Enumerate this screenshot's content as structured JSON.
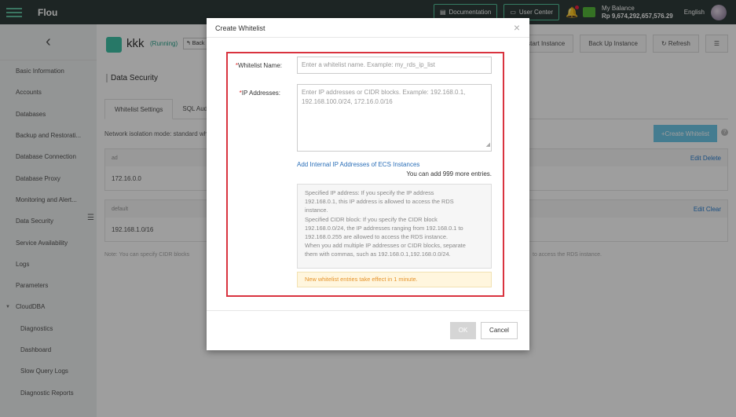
{
  "topbar": {
    "logo_text": "Flou",
    "documentation_label": "Documentation",
    "user_center_label": "User Center",
    "balance_label": "My Balance",
    "balance_value": "Rp 9,674,292,657,576.29",
    "language": "English"
  },
  "sidebar": {
    "back_icon": "‹",
    "items": [
      {
        "label": "Basic Information"
      },
      {
        "label": "Accounts"
      },
      {
        "label": "Databases"
      },
      {
        "label": "Backup and Restorati..."
      },
      {
        "label": "Database Connection"
      },
      {
        "label": "Database Proxy"
      },
      {
        "label": "Monitoring and Alert..."
      },
      {
        "label": "Data Security"
      },
      {
        "label": "Service Availability"
      },
      {
        "label": "Logs"
      },
      {
        "label": "Parameters"
      },
      {
        "label": "CloudDBA"
      },
      {
        "label": "Diagnostics"
      },
      {
        "label": "Dashboard"
      },
      {
        "label": "Slow Query Logs"
      },
      {
        "label": "Diagnostic Reports"
      }
    ]
  },
  "instance": {
    "name": "kkk",
    "status": "(Running)",
    "back_label": "↰ Back"
  },
  "actions": {
    "restart": "Restart Instance",
    "backup": "Back Up Instance",
    "refresh": "↻ Refresh",
    "menu": "☰"
  },
  "page": {
    "section_title": "Data Security",
    "tabs": [
      "Whitelist Settings",
      "SQL Audit"
    ],
    "isolation_mode": "Network isolation mode: standard whitelist.",
    "create_whitelist": "+Create Whitelist",
    "help": "?",
    "groups": [
      {
        "name": "ad",
        "ip": "172.16.0.0",
        "links": "Edit Delete"
      },
      {
        "name": "default",
        "ip": "192.168.1.0/16",
        "links": "Edit Clear"
      }
    ],
    "note_left": "Note: You can specify CIDR blocks",
    "note_right": "to access the RDS instance."
  },
  "modal": {
    "title": "Create Whitelist",
    "close": "×",
    "name_label": "Whitelist Name:",
    "name_placeholder": "Enter a whitelist name. Example: my_rds_ip_list",
    "ip_label": "IP Addresses:",
    "ip_placeholder_lines": [
      "Enter IP addresses or CIDR blocks. Example: 192.168.0.1,",
      "192.168.100.0/24, 172.16.0.0/16"
    ],
    "add_internal_link": "Add Internal IP Addresses of ECS Instances",
    "more_entries": "You can add 999 more entries.",
    "info_lines": [
      "Specified IP address: If you specify the IP address",
      "192.168.0.1, this IP address is allowed to access the RDS",
      "instance.",
      "Specified CIDR block: If you specify the CIDR block",
      "192.168.0.0/24, the IP addresses ranging from 192.168.0.1 to",
      "192.168.0.255 are allowed to access the RDS instance.",
      "When you add multiple IP addresses or CIDR blocks, separate",
      "them with commas, such as 192.168.0.1,192.168.0.0/24."
    ],
    "effect_notice": "New whitelist entries take effect in 1 minute.",
    "ok_label": "OK",
    "cancel_label": "Cancel"
  },
  "colors": {
    "topbar_bg": "#2f3c3a",
    "accent_green": "#56c99f",
    "highlight_red": "#d9333f",
    "link_blue": "#2b6fb8",
    "warning_orange": "#e6932a"
  }
}
